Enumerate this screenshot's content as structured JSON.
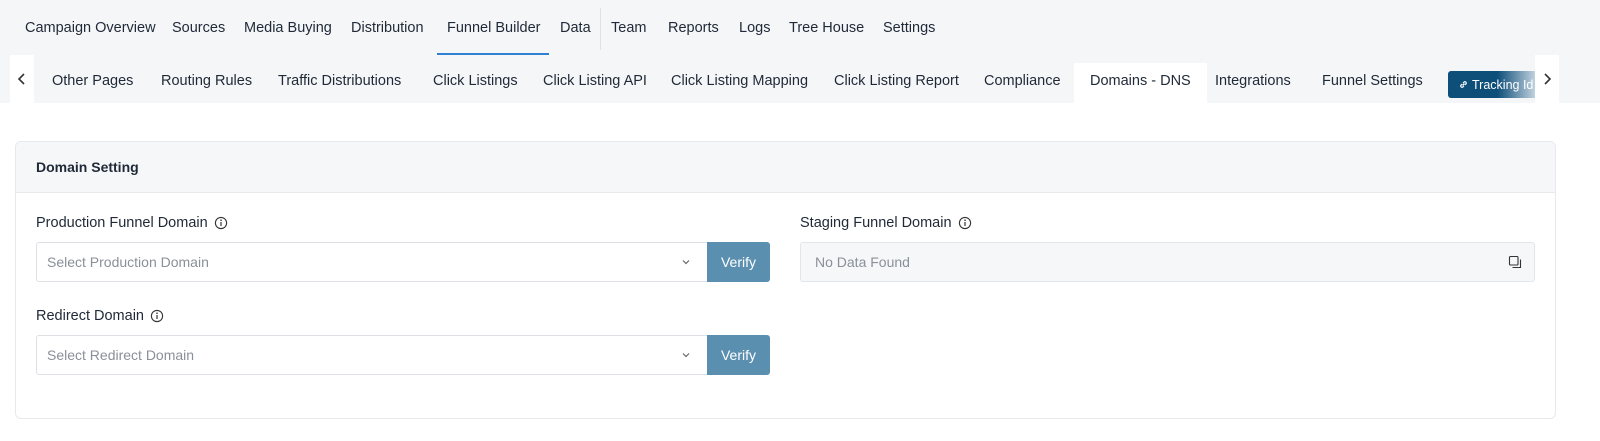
{
  "top_nav": {
    "items": [
      {
        "label": "Campaign Overview"
      },
      {
        "label": "Sources"
      },
      {
        "label": "Media Buying"
      },
      {
        "label": "Distribution"
      },
      {
        "label": "Funnel Builder",
        "active": true
      },
      {
        "label": "Data"
      },
      {
        "label": "Team"
      },
      {
        "label": "Reports"
      },
      {
        "label": "Logs"
      },
      {
        "label": "Tree House"
      },
      {
        "label": "Settings"
      }
    ]
  },
  "sub_nav": {
    "items": [
      {
        "label": "Other Pages"
      },
      {
        "label": "Routing Rules"
      },
      {
        "label": "Traffic Distributions"
      },
      {
        "label": "Click Listings"
      },
      {
        "label": "Click Listing API"
      },
      {
        "label": "Click Listing Mapping"
      },
      {
        "label": "Click Listing Report"
      },
      {
        "label": "Compliance"
      },
      {
        "label": "Domains - DNS",
        "active": true
      },
      {
        "label": "Integrations"
      },
      {
        "label": "Funnel Settings"
      }
    ],
    "tracking_button_label": "Tracking Id",
    "prev_icon": "chevron-left-icon",
    "next_icon": "chevron-right-icon"
  },
  "domain_setting": {
    "title": "Domain Setting",
    "production": {
      "label": "Production Funnel Domain",
      "placeholder": "Select Production Domain",
      "verify_label": "Verify"
    },
    "redirect": {
      "label": "Redirect Domain",
      "placeholder": "Select Redirect Domain",
      "verify_label": "Verify"
    },
    "staging": {
      "label": "Staging Funnel Domain",
      "value": "No Data Found"
    }
  },
  "colors": {
    "accent": "#2f80d1",
    "verify_button": "#5b8fb0",
    "tracking_button": "#0e4f7a"
  }
}
